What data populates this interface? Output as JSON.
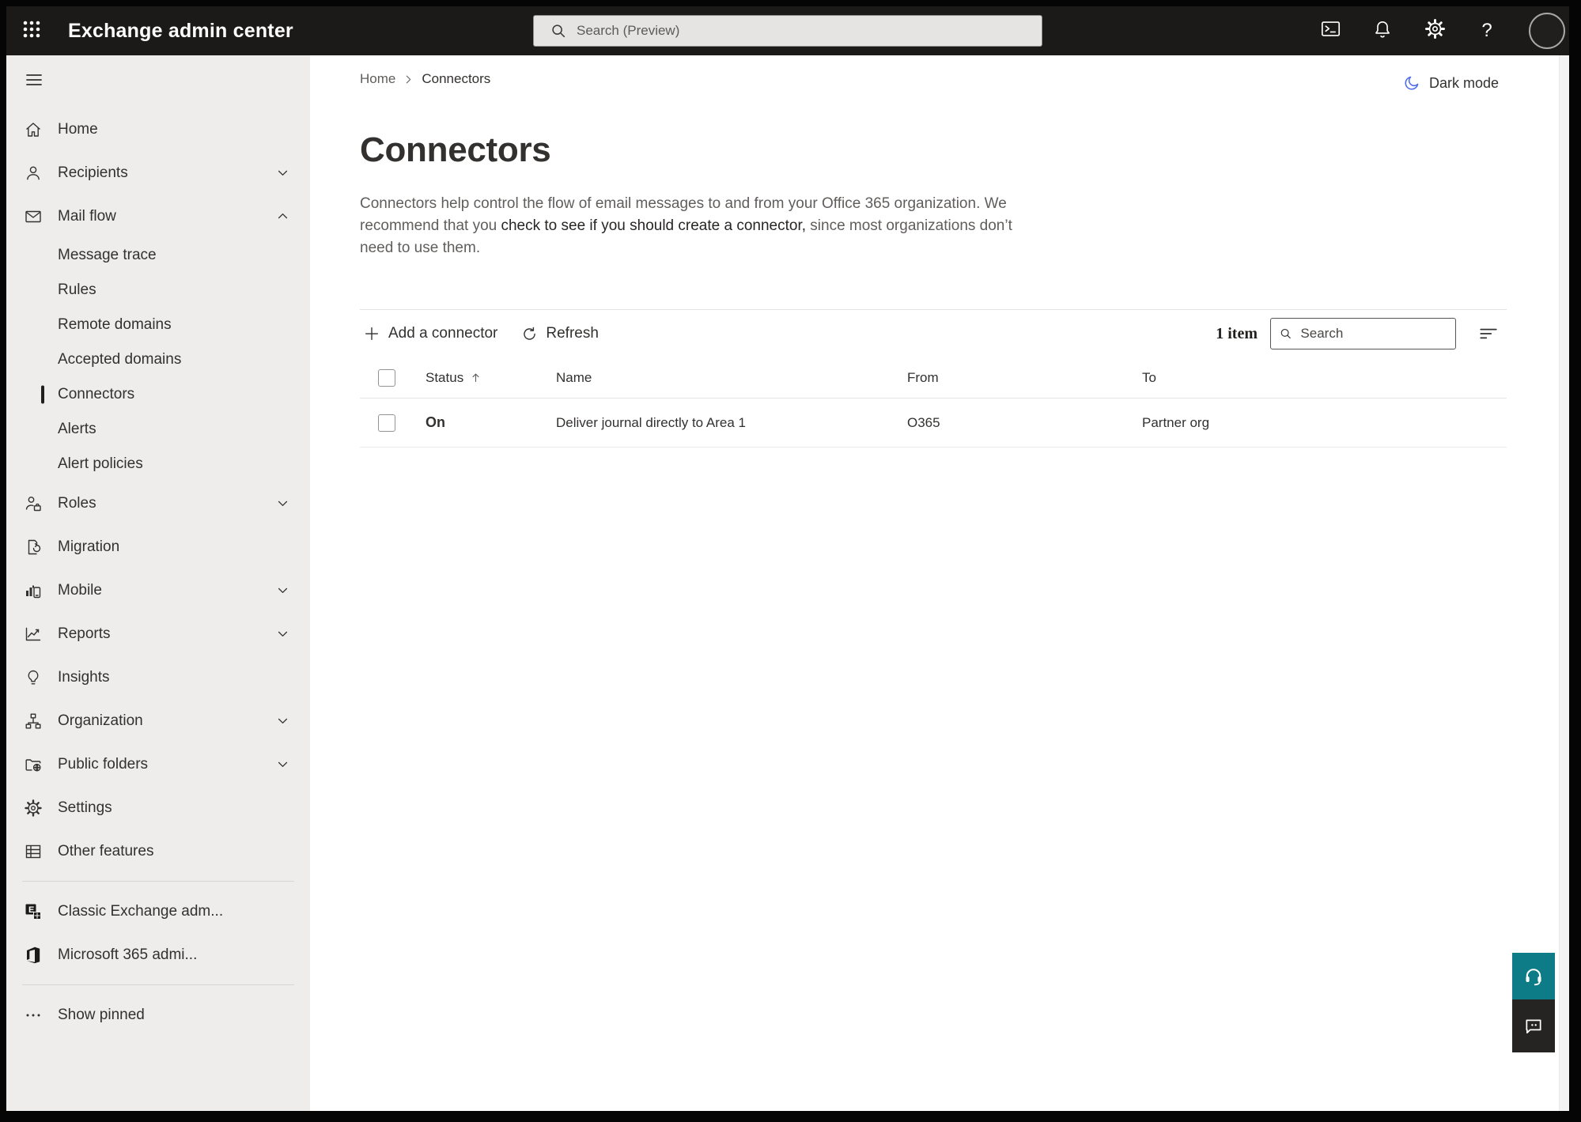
{
  "topbar": {
    "app_title": "Exchange admin center",
    "search_placeholder": "Search (Preview)",
    "icons": {
      "app_launcher": "waffle-grid",
      "terminal": "cloud-shell-terminal",
      "bell": "notifications",
      "gear": "settings",
      "help": "?",
      "avatar": "account-circle"
    }
  },
  "sidebar": {
    "items": [
      {
        "label": "Home"
      },
      {
        "label": "Recipients",
        "chevron": "down"
      },
      {
        "label": "Mail flow",
        "chevron": "up",
        "expanded": true
      },
      {
        "label": "Message trace",
        "sub": true
      },
      {
        "label": "Rules",
        "sub": true
      },
      {
        "label": "Remote domains",
        "sub": true
      },
      {
        "label": "Accepted domains",
        "sub": true
      },
      {
        "label": "Connectors",
        "sub": true,
        "selected": true
      },
      {
        "label": "Alerts",
        "sub": true
      },
      {
        "label": "Alert policies",
        "sub": true
      },
      {
        "label": "Roles",
        "chevron": "down"
      },
      {
        "label": "Migration"
      },
      {
        "label": "Mobile",
        "chevron": "down"
      },
      {
        "label": "Reports",
        "chevron": "down"
      },
      {
        "label": "Insights"
      },
      {
        "label": "Organization",
        "chevron": "down"
      },
      {
        "label": "Public folders",
        "chevron": "down"
      },
      {
        "label": "Settings"
      },
      {
        "label": "Other features"
      },
      {
        "label": "Classic Exchange adm..."
      },
      {
        "label": "Microsoft 365 admi..."
      },
      {
        "label": "Show pinned"
      }
    ]
  },
  "breadcrumb": {
    "home": "Home",
    "current": "Connectors"
  },
  "header_bar": {
    "dark_mode_label": "Dark mode"
  },
  "page": {
    "title": "Connectors",
    "description_before": "Connectors help control the flow of email messages to and from your Office 365 organization. We recommend that you ",
    "description_link": "check to see if you should create a connector,",
    "description_after": " since most organizations don’t need to use them."
  },
  "toolbar": {
    "add_label": "Add a connector",
    "refresh_label": "Refresh",
    "item_count": "1 item",
    "search_placeholder": "Search"
  },
  "table": {
    "columns": [
      "Status",
      "Name",
      "From",
      "To"
    ],
    "sorted_column": "Status",
    "sort_direction": "ascending",
    "rows": [
      {
        "status": "On",
        "name": "Deliver journal directly to Area 1",
        "from": "O365",
        "to": "Partner org"
      }
    ]
  },
  "colors": {
    "topbar_bg": "#1b1a19",
    "sidebar_bg": "#eeedec",
    "accent_teal": "#0e7c86",
    "moon_blue": "#4f6bed",
    "text_dark": "#323130",
    "text_gray": "#605e5c"
  }
}
